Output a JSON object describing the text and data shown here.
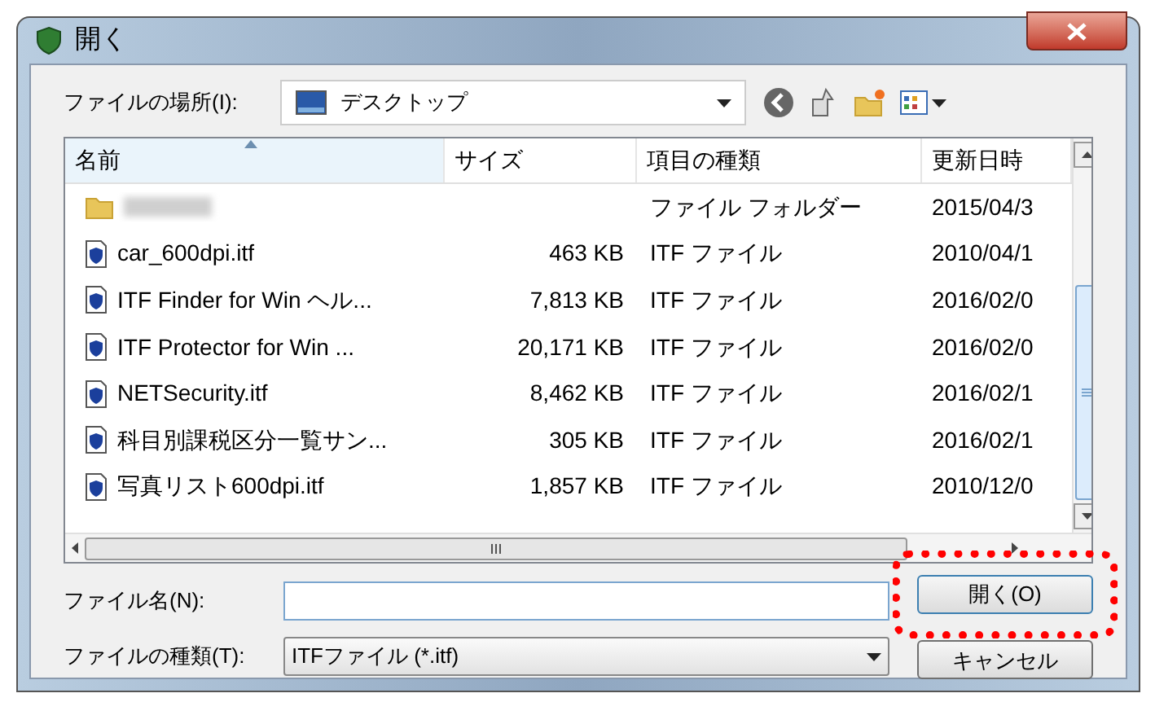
{
  "window": {
    "title": "開く"
  },
  "location": {
    "label": "ファイルの場所(I):",
    "value": "デスクトップ"
  },
  "columns": [
    {
      "label": "名前",
      "sorted": true
    },
    {
      "label": "サイズ",
      "sorted": false
    },
    {
      "label": "項目の種類",
      "sorted": false
    },
    {
      "label": "更新日時",
      "sorted": false
    }
  ],
  "rows": [
    {
      "kind": "folder",
      "name": "",
      "size": "",
      "type": "ファイル フォルダー",
      "date": "2015/04/3"
    },
    {
      "kind": "file",
      "name": "car_600dpi.itf",
      "size": "463 KB",
      "type": "ITF ファイル",
      "date": "2010/04/1"
    },
    {
      "kind": "file",
      "name": "ITF Finder for Win ヘル...",
      "size": "7,813 KB",
      "type": "ITF ファイル",
      "date": "2016/02/0"
    },
    {
      "kind": "file",
      "name": "ITF Protector for Win ...",
      "size": "20,171 KB",
      "type": "ITF ファイル",
      "date": "2016/02/0"
    },
    {
      "kind": "file",
      "name": "NETSecurity.itf",
      "size": "8,462 KB",
      "type": "ITF ファイル",
      "date": "2016/02/1"
    },
    {
      "kind": "file",
      "name": "科目別課税区分一覧サン...",
      "size": "305 KB",
      "type": "ITF ファイル",
      "date": "2016/02/1"
    },
    {
      "kind": "file",
      "name": "写真リスト600dpi.itf",
      "size": "1,857 KB",
      "type": "ITF ファイル",
      "date": "2010/12/0"
    }
  ],
  "filename": {
    "label": "ファイル名(N):"
  },
  "filetype": {
    "label": "ファイルの種類(T):",
    "value": "ITFファイル (*.itf)"
  },
  "buttons": [
    {
      "kind": "open",
      "label": "開く(O)",
      "highlighted": true
    },
    {
      "kind": "cancel",
      "label": "キャンセル",
      "highlighted": false
    }
  ]
}
